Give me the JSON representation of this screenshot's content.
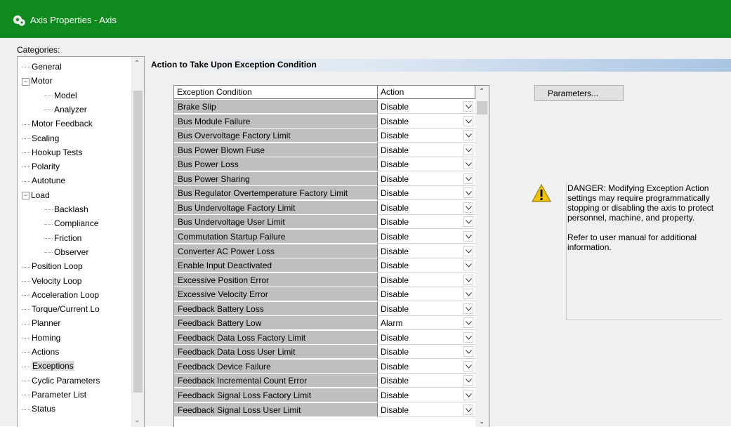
{
  "window": {
    "title": "Axis Properties - Axis"
  },
  "categories_label": "Categories:",
  "tree": [
    {
      "label": "General",
      "level": 0
    },
    {
      "label": "Motor",
      "level": 0,
      "expander": "−"
    },
    {
      "label": "Model",
      "level": 1
    },
    {
      "label": "Analyzer",
      "level": 1
    },
    {
      "label": "Motor Feedback",
      "level": 0
    },
    {
      "label": "Scaling",
      "level": 0
    },
    {
      "label": "Hookup Tests",
      "level": 0
    },
    {
      "label": "Polarity",
      "level": 0
    },
    {
      "label": "Autotune",
      "level": 0
    },
    {
      "label": "Load",
      "level": 0,
      "expander": "−"
    },
    {
      "label": "Backlash",
      "level": 1
    },
    {
      "label": "Compliance",
      "level": 1
    },
    {
      "label": "Friction",
      "level": 1
    },
    {
      "label": "Observer",
      "level": 1
    },
    {
      "label": "Position Loop",
      "level": 0
    },
    {
      "label": "Velocity Loop",
      "level": 0
    },
    {
      "label": "Acceleration Loop",
      "level": 0
    },
    {
      "label": "Torque/Current Lo",
      "level": 0
    },
    {
      "label": "Planner",
      "level": 0
    },
    {
      "label": "Homing",
      "level": 0
    },
    {
      "label": "Actions",
      "level": 0
    },
    {
      "label": "Exceptions",
      "level": 0,
      "selected": true
    },
    {
      "label": "Cyclic Parameters",
      "level": 0
    },
    {
      "label": "Parameter List",
      "level": 0
    },
    {
      "label": "Status",
      "level": 0
    }
  ],
  "section_title": "Action to Take Upon Exception Condition",
  "grid": {
    "headers": [
      "Exception Condition",
      "Action"
    ],
    "rows": [
      {
        "condition": "Brake Slip",
        "action": "Disable"
      },
      {
        "condition": "Bus Module Failure",
        "action": "Disable"
      },
      {
        "condition": "Bus Overvoltage Factory Limit",
        "action": "Disable"
      },
      {
        "condition": "Bus Power Blown Fuse",
        "action": "Disable"
      },
      {
        "condition": "Bus Power Loss",
        "action": "Disable"
      },
      {
        "condition": "Bus Power Sharing",
        "action": "Disable"
      },
      {
        "condition": "Bus Regulator Overtemperature Factory Limit",
        "action": "Disable"
      },
      {
        "condition": "Bus Undervoltage Factory Limit",
        "action": "Disable"
      },
      {
        "condition": "Bus Undervoltage User Limit",
        "action": "Disable"
      },
      {
        "condition": "Commutation Startup Failure",
        "action": "Disable"
      },
      {
        "condition": "Converter AC Power Loss",
        "action": "Disable"
      },
      {
        "condition": "Enable Input Deactivated",
        "action": "Disable"
      },
      {
        "condition": "Excessive Position Error",
        "action": "Disable"
      },
      {
        "condition": "Excessive Velocity Error",
        "action": "Disable"
      },
      {
        "condition": "Feedback Battery Loss",
        "action": "Disable"
      },
      {
        "condition": "Feedback Battery Low",
        "action": "Alarm"
      },
      {
        "condition": "Feedback Data Loss Factory Limit",
        "action": "Disable"
      },
      {
        "condition": "Feedback Data Loss User Limit",
        "action": "Disable"
      },
      {
        "condition": "Feedback Device Failure",
        "action": "Disable"
      },
      {
        "condition": "Feedback Incremental Count Error",
        "action": "Disable"
      },
      {
        "condition": "Feedback Signal Loss Factory Limit",
        "action": "Disable"
      },
      {
        "condition": "Feedback Signal Loss User Limit",
        "action": "Disable"
      }
    ]
  },
  "parameters_button": "Parameters...",
  "danger": {
    "text": "DANGER: Modifying Exception Action settings may require programmatically stopping or disabling the axis to protect personnel, machine, and property.",
    "note": "Refer to user manual for additional information."
  },
  "colors": {
    "titlebar": "#0e8a1f",
    "header_gradient_end": "#a9c4e2",
    "condition_cell": "#bfbfbf",
    "warning": "#f2c200"
  },
  "icons": {
    "app": "gear-icon",
    "warning": "warning-icon"
  }
}
